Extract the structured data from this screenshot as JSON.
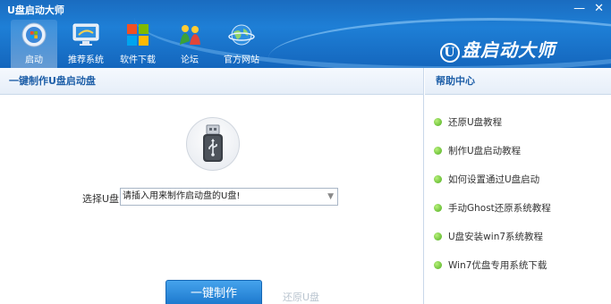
{
  "app_title": "U盘启动大师",
  "window_controls": {
    "minimize": "—",
    "close": "✕"
  },
  "nav": [
    {
      "label": "启动",
      "icon": "windows-disc-icon",
      "active": true
    },
    {
      "label": "推荐系统",
      "icon": "monitor-icon",
      "active": false
    },
    {
      "label": "软件下载",
      "icon": "windows-logo-icon",
      "active": false
    },
    {
      "label": "论坛",
      "icon": "people-icon",
      "active": false
    },
    {
      "label": "官方网站",
      "icon": "globe-icon",
      "active": false
    }
  ],
  "brand": {
    "u": "U",
    "text": "盘启动大师"
  },
  "main": {
    "title": "一键制作U盘启动盘",
    "select_label": "选择U盘",
    "select_value": "请插入用来制作启动盘的U盘!",
    "make_button": "一键制作",
    "restore_button": "还原U盘"
  },
  "help": {
    "title": "帮助中心",
    "items": [
      "还原U盘教程",
      "制作U盘启动教程",
      "如何设置通过U盘启动",
      "手动Ghost还原系统教程",
      "U盘安装win7系统教程",
      "Win7优盘专用系统下载"
    ]
  }
}
